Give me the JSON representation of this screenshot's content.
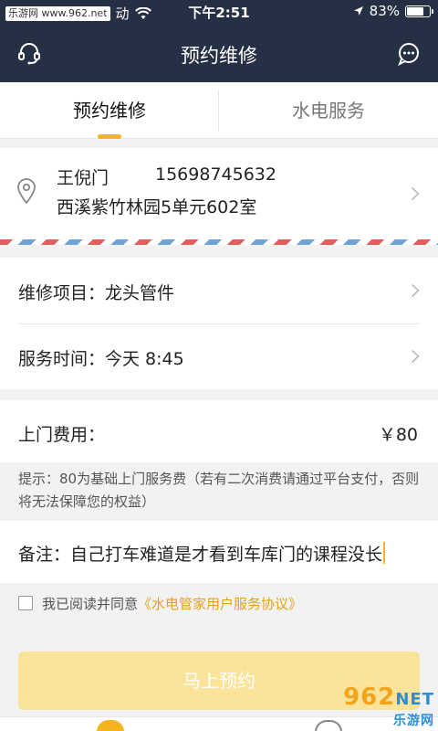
{
  "status_bar": {
    "watermark": "乐游网 www.962.net",
    "carrier_suffix": "动",
    "time": "下午2:51",
    "battery": "83%",
    "battery_level": 0.83
  },
  "nav": {
    "title": "预约维修",
    "left_icon": "headset-icon",
    "right_icon": "chat-bubble-icon"
  },
  "tabs": [
    {
      "label": "预约维修",
      "active": true
    },
    {
      "label": "水电服务",
      "active": false
    }
  ],
  "address": {
    "name": "王倪门",
    "phone": "15698745632",
    "detail": "西溪紫竹林园5单元602室",
    "icon": "location-pin-icon"
  },
  "repair_item": {
    "label": "维修项目：",
    "value": "龙头管件"
  },
  "service_time": {
    "label": "服务时间：",
    "value": "今天 8:45"
  },
  "fee": {
    "label": "上门费用：",
    "value": "￥80"
  },
  "tip": "提示：80为基础上门服务费（若有二次消费请通过平台支付，否则将无法保障您的权益）",
  "remark": {
    "label": "备注：",
    "value": "自己打车难道是才看到车库门的课程没长"
  },
  "agreement": {
    "prefix": "我已阅读并同意",
    "link": "《水电管家用户服务协议》",
    "checked": false
  },
  "submit_label": "马上预约",
  "watermark_logo": {
    "main": "962",
    "suffix": "NET",
    "sub": "乐游网"
  },
  "colors": {
    "nav_bg": "#253044",
    "accent": "#f4b41f",
    "submit_disabled": "#fbe39a",
    "link": "#e4a21a"
  }
}
